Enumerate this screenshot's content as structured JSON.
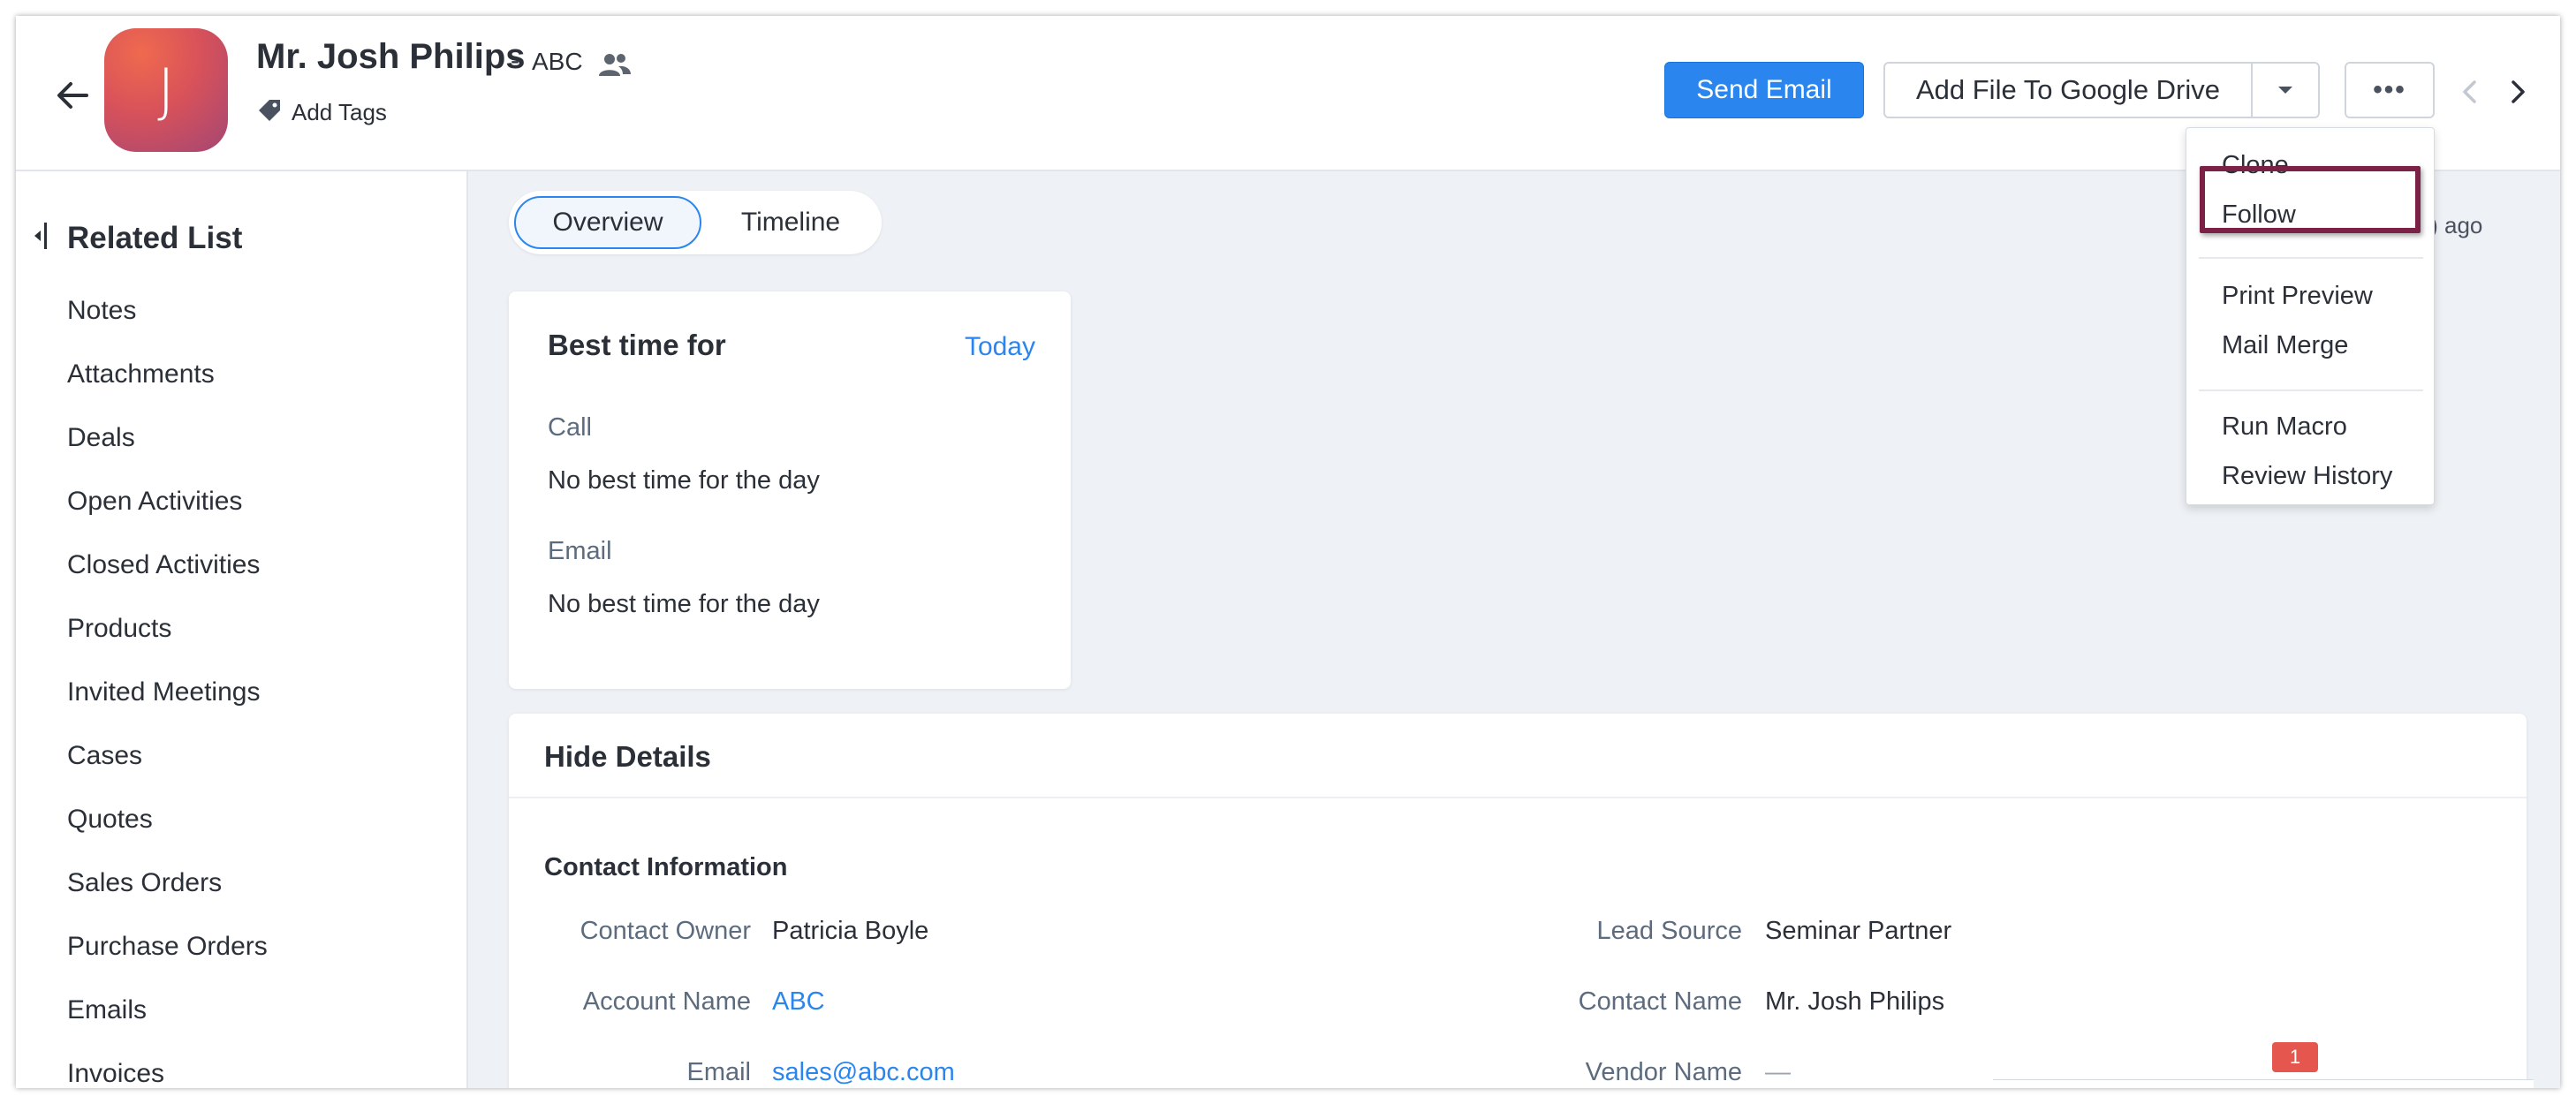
{
  "record": {
    "avatar_letter": "J",
    "name": "Mr. Josh Philips",
    "separator": "-",
    "account": "ABC",
    "add_tags": "Add Tags"
  },
  "toolbar": {
    "send_email": "Send Email",
    "add_file_drive": "Add File To Google Drive",
    "more": "•••"
  },
  "sidebar": {
    "title": "Related List",
    "items": [
      "Notes",
      "Attachments",
      "Deals",
      "Open Activities",
      "Closed Activities",
      "Products",
      "Invited Meetings",
      "Cases",
      "Quotes",
      "Sales Orders",
      "Purchase Orders",
      "Emails",
      "Invoices"
    ]
  },
  "tabs": {
    "overview": "Overview",
    "timeline": "Timeline"
  },
  "updated": "ay(s) ago",
  "best_time": {
    "title": "Best time for",
    "today": "Today",
    "call_label": "Call",
    "call_value": "No best time for the day",
    "email_label": "Email",
    "email_value": "No best time for the day"
  },
  "details": {
    "toggle": "Hide Details",
    "section_title": "Contact Information",
    "left_fields": [
      {
        "label": "Contact Owner",
        "value": "Patricia Boyle"
      },
      {
        "label": "Account Name",
        "value": "ABC"
      },
      {
        "label": "Email",
        "value": "sales@abc.com"
      }
    ],
    "right_fields": [
      {
        "label": "Lead Source",
        "value": "Seminar Partner"
      },
      {
        "label": "Contact Name",
        "value": "Mr. Josh Philips"
      },
      {
        "label": "Vendor Name",
        "value": "—"
      }
    ]
  },
  "more_menu": {
    "items": [
      "Clone",
      "Follow",
      "Print Preview",
      "Mail Merge",
      "Run Macro",
      "Review History"
    ],
    "highlighted": "Follow"
  },
  "notification_count": "1",
  "colors": {
    "accent": "#2a86ee",
    "highlight": "#7c2146",
    "badge": "#e5574e"
  }
}
